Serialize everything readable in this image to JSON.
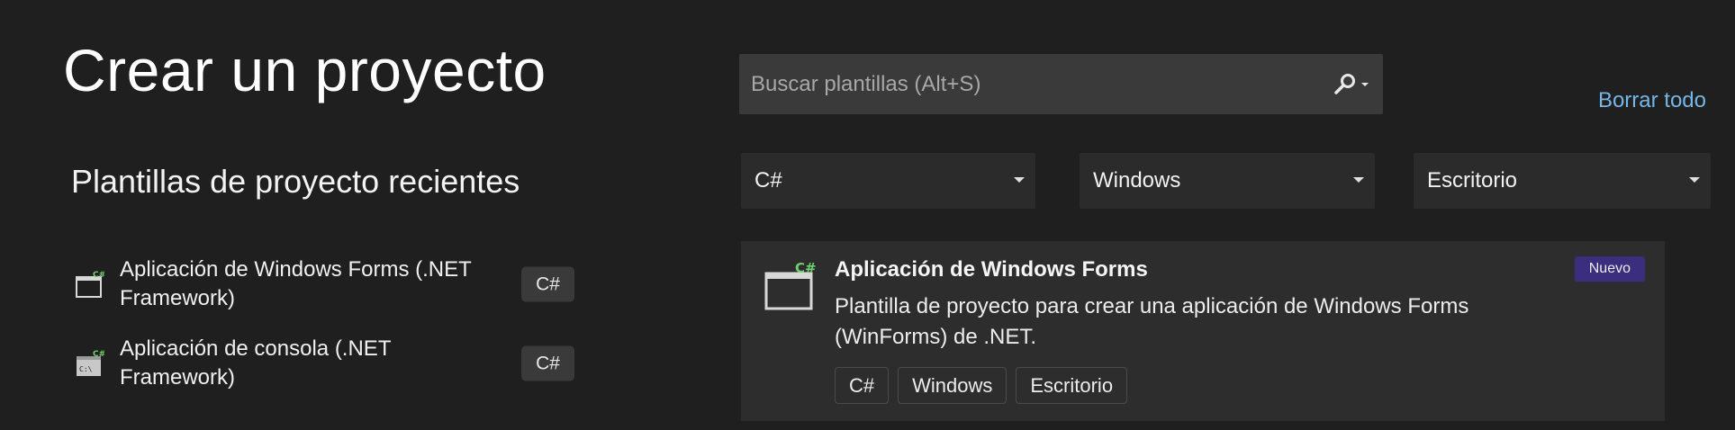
{
  "page": {
    "title": "Crear un proyecto"
  },
  "recent": {
    "heading": "Plantillas de proyecto recientes",
    "items": [
      {
        "label": "Aplicación de Windows Forms (.NET Framework)",
        "lang": "C#",
        "icon": "windows-forms-app-icon"
      },
      {
        "label": "Aplicación de consola (.NET Framework)",
        "lang": "C#",
        "icon": "console-app-icon"
      }
    ]
  },
  "search": {
    "placeholder": "Buscar plantillas (Alt+S)",
    "value": "",
    "icon": "search-icon"
  },
  "clear_all": "Borrar todo",
  "filters": {
    "language": "C#",
    "platform": "Windows",
    "project_type": "Escritorio"
  },
  "template": {
    "name": "Aplicación de Windows Forms",
    "description": "Plantilla de proyecto para crear una aplicación de Windows Forms (WinForms) de .NET.",
    "badge": "Nuevo",
    "tags": [
      "C#",
      "Windows",
      "Escritorio"
    ],
    "icon": "windows-forms-app-icon"
  },
  "colors": {
    "background": "#1f1f1f",
    "link": "#75b6e7",
    "badge": "#3b2e7e",
    "csharp_green": "#6fcf6f"
  }
}
